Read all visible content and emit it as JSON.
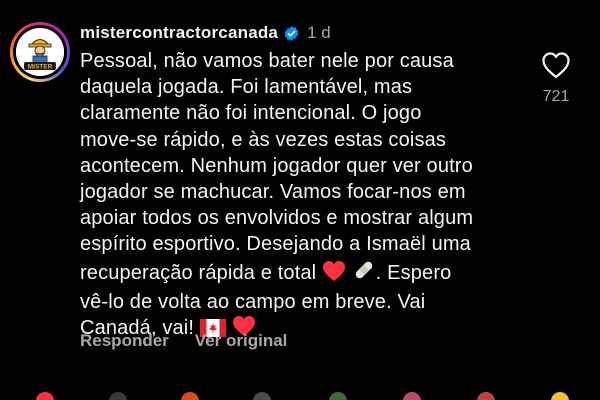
{
  "post": {
    "username": "mistercontractorcanada",
    "verified": true,
    "time": "1 d",
    "avatar_logo_text": "MISTER",
    "comment_lines": [
      "Pessoal, não vamos bater nele por causa",
      "daquela jogada. Foi lamentável, mas",
      "claramente não foi intencional. O jogo",
      "move-se rápido, e às vezes estas coisas",
      "acontecem. Nenhum jogador quer ver outro",
      "jogador se machucar. Vamos focar-nos em",
      "apoiar todos os envolvidos e mostrar algum",
      "espírito esportivo. Desejando a Ismaël uma",
      "recuperação rápida e total",
      ". Espero",
      "vê-lo de volta ao campo em breve. Vai",
      "Canadá, vai!"
    ],
    "like_count": "721",
    "reply_label": "Responder",
    "see_original_label": "Ver original"
  },
  "icons": {
    "heart": "heart-icon",
    "verified": "verified-badge-icon",
    "emoji_red_heart": "red-heart-emoji",
    "emoji_bandage": "adhesive-bandage-emoji",
    "emoji_canada_flag": "canada-flag-emoji"
  },
  "colors": {
    "background": "#000000",
    "text": "#f5f5f5",
    "secondary_text": "#a8a8a8",
    "verified_blue": "#0095f6",
    "heart_red": "#ff3040"
  }
}
